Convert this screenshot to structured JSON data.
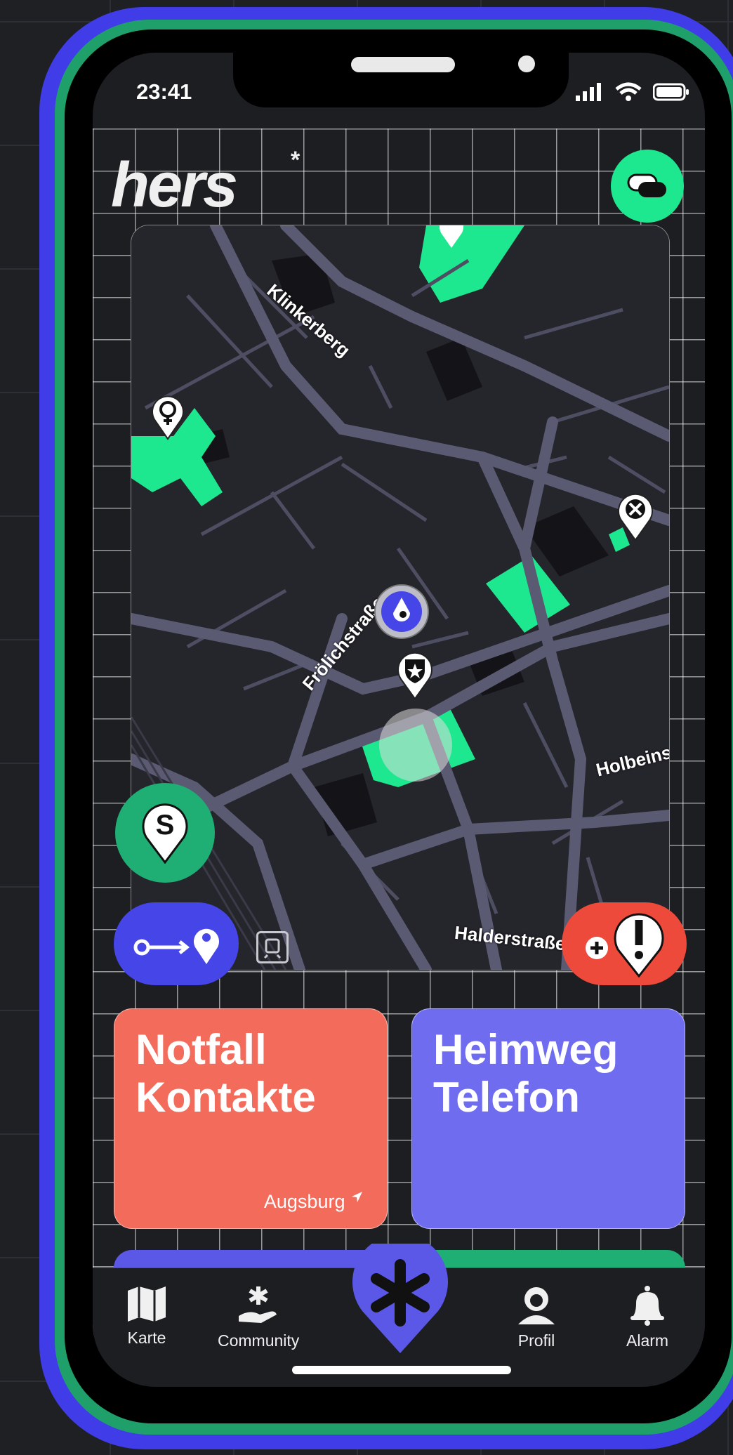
{
  "status_bar": {
    "time": "23:41"
  },
  "app": {
    "logo_text": "hers",
    "logo_mark": "*"
  },
  "header": {
    "toggle_icon": "toggle-icon"
  },
  "map": {
    "streets": [
      "Klinkerberg",
      "Frölichstraße",
      "Holbeinstraße",
      "Halderstraße"
    ],
    "markers": [
      "women-marker-icon",
      "cross-marker-icon",
      "star-shield-marker-icon",
      "user-location-icon"
    ],
    "colors": {
      "park": "#1ee88f",
      "road": "#5a5a72",
      "background": "#25252c"
    }
  },
  "fabs": {
    "safe_label": "S",
    "route_icon": "route-to-pin-icon",
    "report_icon": "report-alert-icon",
    "transit_icon": "train-icon"
  },
  "cards": [
    {
      "title_line1": "Notfall",
      "title_line2": "Kontakte",
      "location": "Augsburg",
      "color": "#f36b5b"
    },
    {
      "title_line1": "Heimweg",
      "title_line2": "Telefon",
      "color": "#6f6cf0"
    }
  ],
  "tabs": {
    "map": "Karte",
    "community": "Community",
    "profile": "Profil",
    "alarm": "Alarm"
  },
  "colors": {
    "accent_green": "#1ee88f",
    "accent_blue": "#4545e8",
    "accent_red": "#ee4a3b"
  }
}
